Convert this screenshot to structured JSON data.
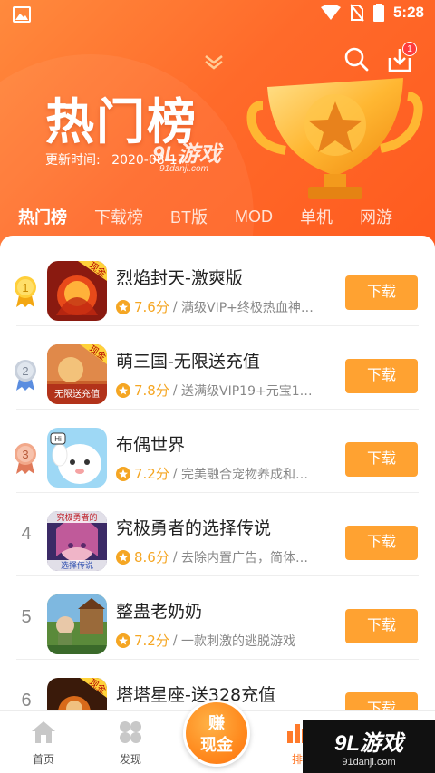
{
  "status_bar": {
    "time": "5:28"
  },
  "header": {
    "title": "热门榜",
    "update_label": "更新时间:",
    "update_date": "2020-08-17",
    "watermark": "9L游戏",
    "watermark_sub": "91danji.com",
    "download_badge": "1"
  },
  "tabs": [
    {
      "label": "热门榜",
      "active": true
    },
    {
      "label": "下载榜"
    },
    {
      "label": "BT版"
    },
    {
      "label": "MOD"
    },
    {
      "label": "单机"
    },
    {
      "label": "网游"
    }
  ],
  "games": [
    {
      "rank": "1",
      "name": "烈焰封天-激爽版",
      "score": "7.6分",
      "desc": "满级VIP+终极热血神…",
      "button": "下载",
      "icon_badge": "现金"
    },
    {
      "rank": "2",
      "name": "萌三国-无限送充值",
      "score": "7.8分",
      "desc": "送满级VIP19+元宝1…",
      "button": "下载",
      "icon_badge": "现金",
      "icon_caption": "无限送充值"
    },
    {
      "rank": "3",
      "name": "布偶世界",
      "score": "7.2分",
      "desc": "完美融合宠物养成和…",
      "button": "下载",
      "icon_badge": "Hi"
    },
    {
      "rank": "4",
      "name": "究极勇者的选择传说",
      "score": "8.6分",
      "desc": "去除内置广告，简体…",
      "button": "下载",
      "icon_badge": "究极勇者的",
      "icon_caption": "选择传说"
    },
    {
      "rank": "5",
      "name": "整蛊老奶奶",
      "score": "7.2分",
      "desc": "一款刺激的逃脱游戏",
      "button": "下载"
    },
    {
      "rank": "6",
      "name": "塔塔星座-送328充值",
      "score": "",
      "desc": "",
      "button": "下载",
      "icon_badge": "现金"
    }
  ],
  "bottom_nav": {
    "home": "首页",
    "discover": "发现",
    "earn_line1": "赚",
    "earn_line2": "现金",
    "rank": "排"
  },
  "watermark_bottom": {
    "main": "9L游戏",
    "sub": "91danji.com"
  },
  "colors": {
    "header": "#ff6a2a",
    "button": "#ffa231",
    "score": "#f5a623"
  }
}
